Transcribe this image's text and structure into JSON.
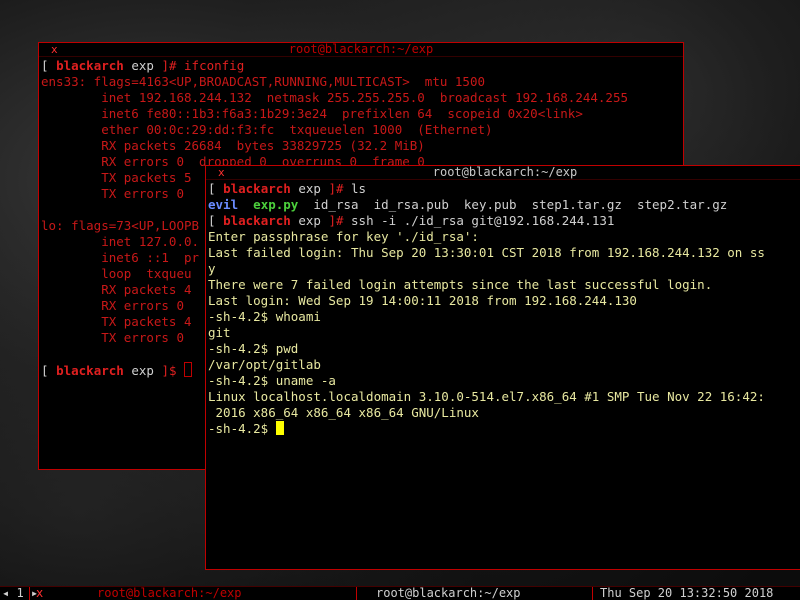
{
  "win1": {
    "title": "root@blackarch:~/exp",
    "close": "x",
    "lines": [
      [
        {
          "t": "[ ",
          "c": "wht"
        },
        {
          "t": "blackarch",
          "c": "red bold"
        },
        {
          "t": " exp ",
          "c": "wht"
        },
        {
          "t": "]# ",
          "c": "red"
        },
        {
          "t": "ifconfig",
          "c": "red"
        }
      ],
      [
        {
          "t": "ens33: flags=4163<UP,BROADCAST,RUNNING,MULTICAST>  mtu 1500",
          "c": "dred"
        }
      ],
      [
        {
          "t": "        inet 192.168.244.132  netmask 255.255.255.0  broadcast 192.168.244.255",
          "c": "dred"
        }
      ],
      [
        {
          "t": "        inet6 fe80::1b3:f6a3:1b29:3e24  prefixlen 64  scopeid 0x20<link>",
          "c": "dred"
        }
      ],
      [
        {
          "t": "        ether 00:0c:29:dd:f3:fc  txqueuelen 1000  (Ethernet)",
          "c": "dred"
        }
      ],
      [
        {
          "t": "        RX packets 26684  bytes 33829725 (32.2 MiB)",
          "c": "dred"
        }
      ],
      [
        {
          "t": "        RX errors 0  dropped 0  overruns 0  frame 0",
          "c": "dred"
        }
      ],
      [
        {
          "t": "        TX packets 5",
          "c": "dred"
        }
      ],
      [
        {
          "t": "        TX errors 0",
          "c": "dred"
        }
      ],
      [
        {
          "t": "",
          "c": "dred"
        }
      ],
      [
        {
          "t": "lo: flags=73<UP,LOOPB",
          "c": "dred"
        }
      ],
      [
        {
          "t": "        inet 127.0.0.",
          "c": "dred"
        }
      ],
      [
        {
          "t": "        inet6 ::1  pr",
          "c": "dred"
        }
      ],
      [
        {
          "t": "        loop  txqueu",
          "c": "dred"
        }
      ],
      [
        {
          "t": "        RX packets 4",
          "c": "dred"
        }
      ],
      [
        {
          "t": "        RX errors 0",
          "c": "dred"
        }
      ],
      [
        {
          "t": "        TX packets 4",
          "c": "dred"
        }
      ],
      [
        {
          "t": "        TX errors 0",
          "c": "dred"
        }
      ],
      [
        {
          "t": "",
          "c": "dred"
        }
      ],
      [
        {
          "t": "[ ",
          "c": "wht"
        },
        {
          "t": "blackarch",
          "c": "red bold"
        },
        {
          "t": " exp ",
          "c": "wht"
        },
        {
          "t": "]$ ",
          "c": "red"
        }
      ]
    ]
  },
  "win2": {
    "title": "root@blackarch:~/exp",
    "close": "x",
    "lines": [
      [
        {
          "t": "[ ",
          "c": "wht"
        },
        {
          "t": "blackarch",
          "c": "red bold"
        },
        {
          "t": " exp ",
          "c": "wht"
        },
        {
          "t": "]# ",
          "c": "red"
        },
        {
          "t": "ls",
          "c": "wht"
        }
      ],
      [
        {
          "t": "evil",
          "c": "blu bold"
        },
        {
          "t": "  ",
          "c": "wht"
        },
        {
          "t": "exp.py",
          "c": "grn bold"
        },
        {
          "t": "  id_rsa  id_rsa.pub  key.pub  step1.tar.gz  step2.tar.gz",
          "c": "wht"
        }
      ],
      [
        {
          "t": "[ ",
          "c": "wht"
        },
        {
          "t": "blackarch",
          "c": "red bold"
        },
        {
          "t": " exp ",
          "c": "wht"
        },
        {
          "t": "]# ",
          "c": "red"
        },
        {
          "t": "ssh -i ./id_rsa git@192.168.244.131",
          "c": "wht"
        }
      ],
      [
        {
          "t": "Enter passphrase for key './id_rsa':",
          "c": "yel"
        }
      ],
      [
        {
          "t": "Last failed login: Thu Sep 20 13:30:01 CST 2018 from 192.168.244.132 on ss",
          "c": "yel"
        }
      ],
      [
        {
          "t": "y",
          "c": "yel"
        }
      ],
      [
        {
          "t": "There were 7 failed login attempts since the last successful login.",
          "c": "yel"
        }
      ],
      [
        {
          "t": "Last login: Wed Sep 19 14:00:11 2018 from 192.168.244.130",
          "c": "yel"
        }
      ],
      [
        {
          "t": "-sh-4.2$ whoami",
          "c": "yel"
        }
      ],
      [
        {
          "t": "git",
          "c": "yel"
        }
      ],
      [
        {
          "t": "-sh-4.2$ pwd",
          "c": "yel"
        }
      ],
      [
        {
          "t": "/var/opt/gitlab",
          "c": "yel"
        }
      ],
      [
        {
          "t": "-sh-4.2$ uname -a",
          "c": "yel"
        }
      ],
      [
        {
          "t": "Linux localhost.localdomain 3.10.0-514.el7.x86_64 #1 SMP Tue Nov 22 16:42:",
          "c": "yel"
        }
      ],
      [
        {
          "t": " 2016 x86_64 x86_64 x86_64 GNU/Linux",
          "c": "yel"
        }
      ],
      [
        {
          "t": "-sh-4.2$ ",
          "c": "yel"
        }
      ]
    ]
  },
  "statusbar": {
    "tag": "◂ 1 ▸",
    "close_marker": "x",
    "inactive_title": "root@blackarch:~/exp",
    "active_title": "root@blackarch:~/exp",
    "datetime": "Thu Sep 20 13:32:50 2018"
  },
  "colors": {
    "accent": "#c00000",
    "prompt_red": "#e02020",
    "output_yellow": "#e8e8a0",
    "dir_blue": "#6b8cff",
    "exec_green": "#4ccf3c",
    "cursor": "#ffff00"
  }
}
